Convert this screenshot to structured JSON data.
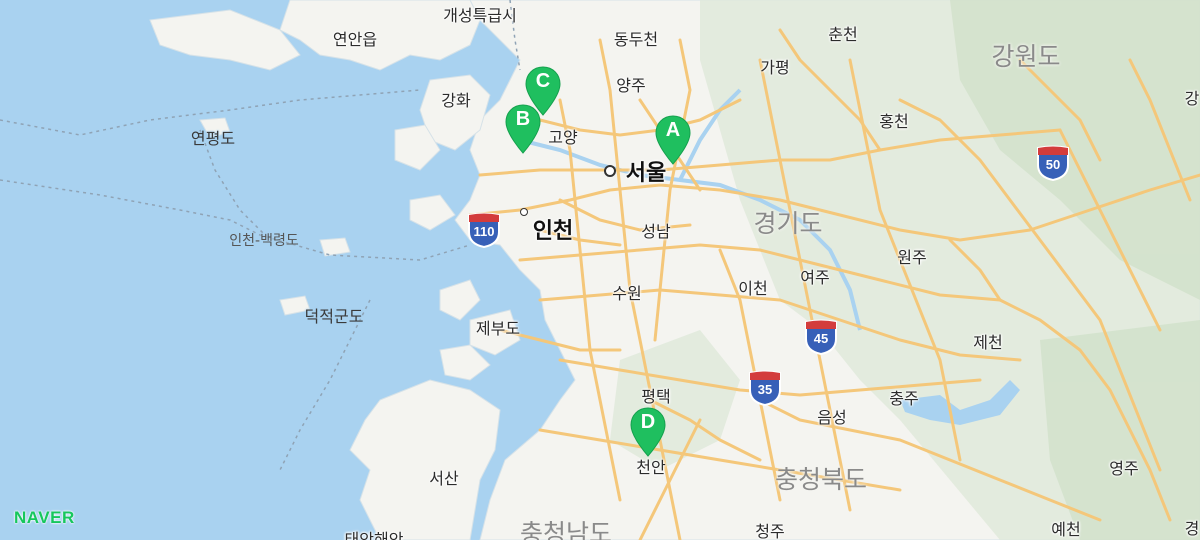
{
  "brand": "NAVER",
  "colors": {
    "sea": "#a9d2f0",
    "land": "#f4f4f0",
    "road": "#f4c77a",
    "pin": "#1fbf5f",
    "shield_top": "#d33c3c",
    "shield_body": "#3760b8"
  },
  "labels": {
    "kaesong": "개성특급시",
    "yeonan": "연안읍",
    "dongducheon": "동두천",
    "chuncheon": "춘천",
    "gangwon": "강원도",
    "ganghwa": "강화",
    "yangju": "양주",
    "gapyeong": "가평",
    "yeonpyeong": "연평도",
    "goyang": "고양",
    "hongcheon": "홍천",
    "seoul": "서울",
    "gyeonggi": "경기도",
    "incheon": "인천",
    "seongnam": "성남",
    "incheon_baengnyeong": "인천-백령도",
    "wonju": "원주",
    "suwon": "수원",
    "icheon": "이천",
    "yeoju": "여주",
    "deokjeok": "덕적군도",
    "jebu": "제부도",
    "jecheon": "제천",
    "pyeongtaek": "평택",
    "chungju": "충주",
    "eumseong": "음성",
    "cheonan": "천안",
    "seosan": "서산",
    "yeongju": "영주",
    "chungbuk": "충청북도",
    "chungnam": "충청남도",
    "cheongju": "청주",
    "taean": "태안해안",
    "yecheon": "예천",
    "gyeong_edge": "경",
    "gang_edge": "강"
  },
  "markers": [
    {
      "letter": "A"
    },
    {
      "letter": "B"
    },
    {
      "letter": "C"
    },
    {
      "letter": "D"
    }
  ],
  "routes": [
    "110",
    "50",
    "45",
    "35"
  ]
}
